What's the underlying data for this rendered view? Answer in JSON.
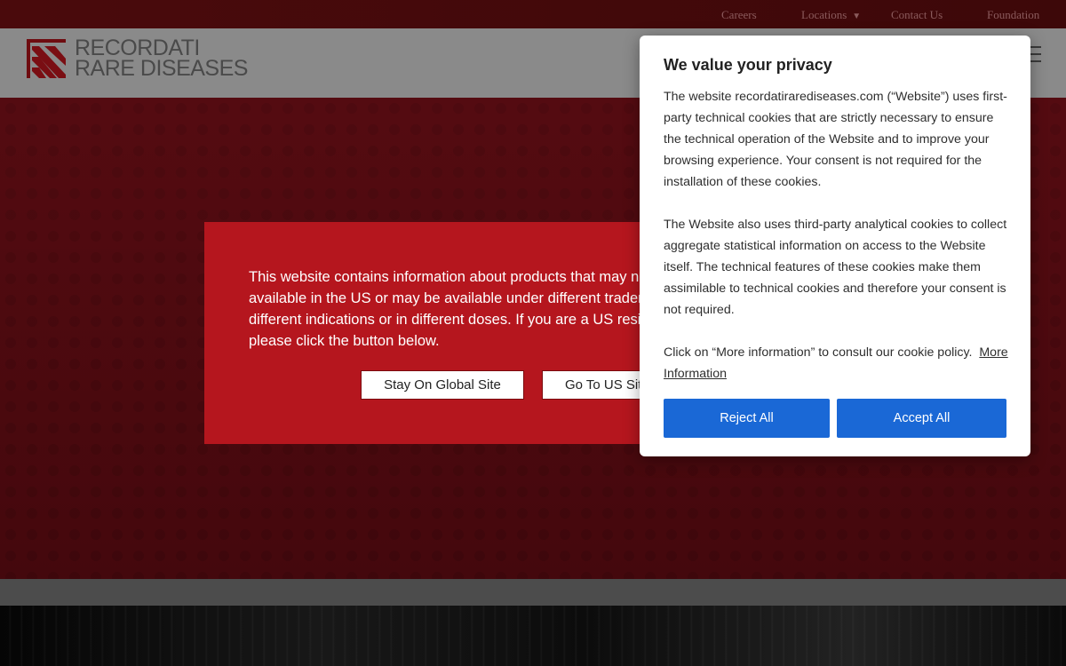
{
  "topbar": {
    "links": [
      "Careers",
      "Locations",
      "Contact Us",
      "Foundation"
    ],
    "caret": "▼"
  },
  "header": {
    "logo_line1": "RECORDATI",
    "logo_line2": "RARE DISEASES"
  },
  "region_modal": {
    "text": "This website contains information about products that may not be available in the US or may be available under different trademarks, for different indications or in different doses. If you are a US resident please click the button below.",
    "stay_label": "Stay On Global Site",
    "go_label": "Go To US Site"
  },
  "cookie": {
    "title": "We value your privacy",
    "p1": "The website recordatirarediseases.com (“Website”) uses first-party technical cookies that are strictly necessary to ensure the technical operation of the Website and to improve your browsing experience. Your consent is not required for the installation of these cookies.",
    "p2": "The Website also uses third-party analytical cookies to collect aggregate statistical information on access to the Website itself. The technical features of these cookies make them assimilable to technical cookies and therefore your consent is not required.",
    "p3": "Click on “More information” to consult our cookie policy.",
    "more_label": "More Information",
    "reject_label": "Reject All",
    "accept_label": "Accept All"
  },
  "colors": {
    "brand_red": "#b5161e",
    "button_blue": "#1a68d6"
  }
}
